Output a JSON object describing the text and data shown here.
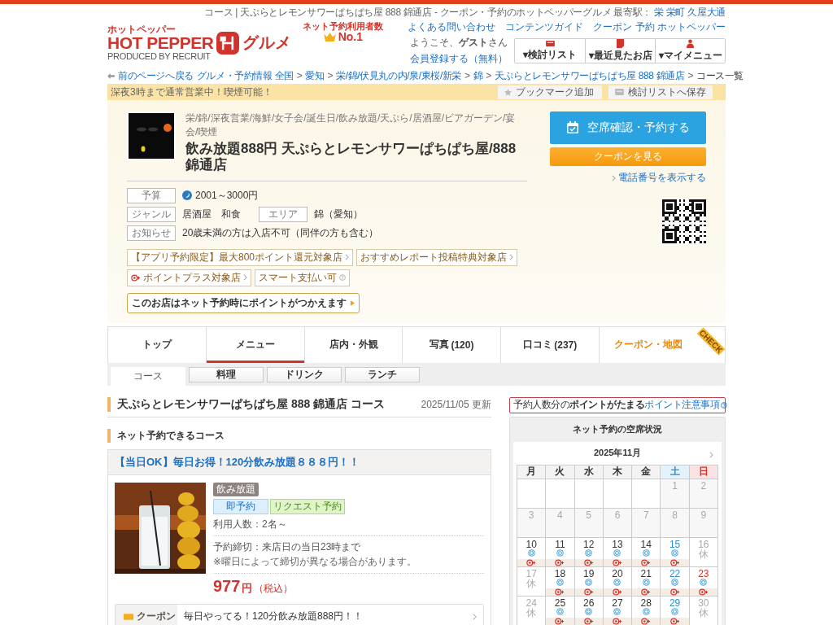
{
  "header": {
    "logo": {
      "kana": "ホットペッパー",
      "name": "HOT PEPPER",
      "producer": "PRODUCED BY RECRUIT",
      "gourmet": "グルメ"
    },
    "ranking": {
      "caption": "ネット予約利用者数",
      "rank": "No.1"
    },
    "page_title": "コース | 天ぷらとレモンサワーぱちぱち屋 888 錦通店 - クーポン・予約のホットペッパーグルメ",
    "stations_label": "最寄駅：",
    "stations": [
      "栄",
      "栄町",
      "久屋大通"
    ],
    "links": [
      "よくある問い合わせ",
      "コンテンツガイド",
      "クーポン 予約 ホットペッパー"
    ],
    "welcome": "ようこそ、**ゲスト**さん",
    "register": "会員登録する（無料）",
    "menu_buttons": [
      {
        "label": "▾検討リスト",
        "kind": "list"
      },
      {
        "label": "▾最近見たお店",
        "kind": "history"
      },
      {
        "label": "▾マイメニュー",
        "kind": "person"
      }
    ]
  },
  "breadcrumb": {
    "back": "前のページへ戻る",
    "separator": ">",
    "items": [
      "グルメ・予約情報 全国",
      "愛知",
      "栄/錦/伏見丸の内/泉/東桜/新栄",
      "錦",
      "天ぷらとレモンサワーぱちぱち屋 888 錦通店",
      "コース一覧"
    ]
  },
  "notice": {
    "text": "深夜3時まで通常営業中！喫煙可能！",
    "buttons": [
      {
        "label": "ブックマーク追加",
        "kind": "star"
      },
      {
        "label": "検討リストへ保存",
        "kind": "list"
      }
    ]
  },
  "shop": {
    "genres": "栄/錦/深夜営業/海鮮/女子会/誕生日/飲み放題/天ぷら/居酒屋/ビアガーデン/宴会/喫煙",
    "name": "飲み放題888円 天ぷらとレモンサワーぱちぱち屋/888 錦通店",
    "info": [
      {
        "fields": [
          {
            "label": "予算",
            "value": "2001～3000円",
            "kind": "dinner"
          }
        ]
      },
      {
        "fields": [
          {
            "label": "ジャンル",
            "value": "居酒屋　和食",
            "kind": "plain"
          },
          {
            "label": "エリア",
            "value": "錦（愛知）",
            "kind": "plain"
          }
        ]
      },
      {
        "fields": [
          {
            "label": "お知らせ",
            "value": "20歳未満の方は入店不可（同伴の方も含む）",
            "kind": "plain"
          }
        ]
      }
    ],
    "badges": [
      {
        "label": "【アプリ予約限定】最大800ポイント還元対象店",
        "kind": "link"
      },
      {
        "label": "おすすめレポート投稿特典対象店",
        "kind": "link"
      },
      {
        "label": "ポイントプラス対象店",
        "kind": "pointplus"
      },
      {
        "label": "スマート支払い可",
        "kind": "help"
      }
    ],
    "point_banner": "このお店はネット予約時にポイントがつかえます",
    "reserve_button": "空席確認・予約する",
    "coupon_button": "クーポンを見る",
    "phone_link": "電話番号を表示する"
  },
  "tabs": [
    {
      "label": "トップ",
      "selected": false,
      "kind": "normal"
    },
    {
      "label": "メニュー",
      "selected": true,
      "kind": "normal"
    },
    {
      "label": "店内・外観",
      "selected": false,
      "kind": "normal"
    },
    {
      "label": "写真",
      "count": "(120)",
      "selected": false,
      "kind": "normal"
    },
    {
      "label": "口コミ",
      "count": "(237)",
      "selected": false,
      "kind": "normal"
    },
    {
      "label": "クーポン・地図",
      "selected": false,
      "kind": "coupon",
      "ribbon": "CHECK"
    }
  ],
  "subtabs": [
    {
      "label": "コース",
      "selected": true
    },
    {
      "label": "料理",
      "selected": false
    },
    {
      "label": "ドリンク",
      "selected": false
    },
    {
      "label": "ランチ",
      "selected": false
    }
  ],
  "content": {
    "heading": "天ぷらとレモンサワーぱちぱち屋 888 錦通店 コース",
    "updated": "2025/11/05 更新",
    "section": "ネット予約できるコース",
    "course": {
      "title": "【当日OK】毎日お得！120分飲み放題８８８円！！",
      "category": "飲み放題",
      "tags": [
        {
          "label": "即予約",
          "kind": "instant"
        },
        {
          "label": "リクエスト予約",
          "kind": "request"
        }
      ],
      "people": "利用人数：2名～",
      "deadline": "予約締切：来店日の当日23時まで",
      "deadline_note": "※曜日によって締切が異なる場合があります。",
      "price": "977",
      "currency": "円",
      "tax": "（税込）",
      "coupon": {
        "label": "クーポン",
        "text": "毎日やってる！120分飲み放題888円！！"
      }
    }
  },
  "sidebar": {
    "point_notice": {
      "text": "予約人数分の**ポイントがたまる**",
      "link": "ポイント注意事項"
    },
    "calendar": {
      "title": "ネット予約の空席状況",
      "month": "2025年11月",
      "weekdays": [
        "月",
        "火",
        "水",
        "木",
        "金",
        "土",
        "日"
      ],
      "weeks": [
        [
          {
            "kind": "blank"
          },
          {
            "kind": "blank"
          },
          {
            "kind": "blank"
          },
          {
            "kind": "blank"
          },
          {
            "kind": "blank"
          },
          {
            "day": "1",
            "kind": "past"
          },
          {
            "day": "2",
            "kind": "past"
          }
        ],
        [
          {
            "day": "3",
            "kind": "past"
          },
          {
            "day": "4",
            "kind": "past"
          },
          {
            "day": "5",
            "kind": "past"
          },
          {
            "day": "6",
            "kind": "past"
          },
          {
            "day": "7",
            "kind": "past"
          },
          {
            "day": "8",
            "kind": "past"
          },
          {
            "day": "9",
            "kind": "past"
          }
        ],
        [
          {
            "day": "10",
            "kind": "open",
            "points": true
          },
          {
            "day": "11",
            "kind": "open",
            "points": true
          },
          {
            "day": "12",
            "kind": "open",
            "points": true
          },
          {
            "day": "13",
            "kind": "open",
            "points": true
          },
          {
            "day": "14",
            "kind": "open",
            "points": true
          },
          {
            "day": "15",
            "kind": "open",
            "points": true
          },
          {
            "day": "16",
            "kind": "closed",
            "note": "休"
          }
        ],
        [
          {
            "day": "17",
            "kind": "closed",
            "note": "休"
          },
          {
            "day": "18",
            "kind": "open",
            "points": true
          },
          {
            "day": "19",
            "kind": "open",
            "points": true
          },
          {
            "day": "20",
            "kind": "open",
            "points": true
          },
          {
            "day": "21",
            "kind": "open",
            "points": true
          },
          {
            "day": "22",
            "kind": "open",
            "points": true
          },
          {
            "day": "23",
            "kind": "open",
            "points": true
          }
        ],
        [
          {
            "day": "24",
            "kind": "closed",
            "note": "休"
          },
          {
            "day": "25",
            "kind": "open",
            "points": true
          },
          {
            "day": "26",
            "kind": "open",
            "points": true
          },
          {
            "day": "27",
            "kind": "open",
            "points": true
          },
          {
            "day": "28",
            "kind": "open",
            "points": true
          },
          {
            "day": "29",
            "kind": "open",
            "points": true
          },
          {
            "day": "30",
            "kind": "closed",
            "note": "休"
          }
        ]
      ]
    }
  }
}
